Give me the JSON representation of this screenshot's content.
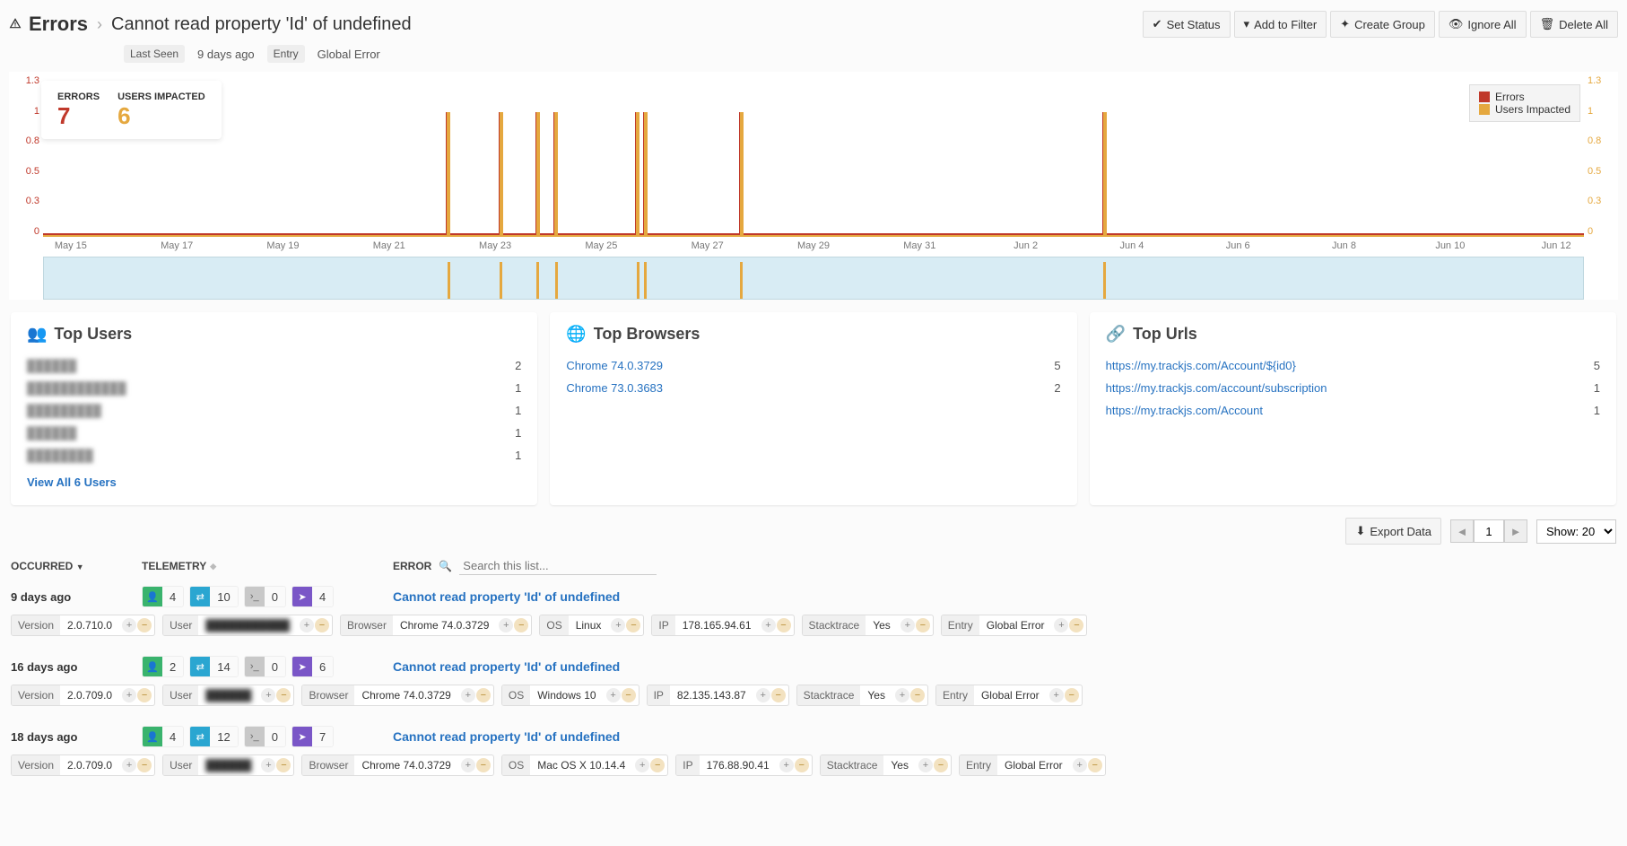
{
  "page": {
    "title": "Errors",
    "error_name": "Cannot read property 'Id' of undefined",
    "last_seen_label": "Last Seen",
    "last_seen_value": "9 days ago",
    "entry_label": "Entry",
    "entry_value": "Global Error"
  },
  "actions": {
    "set_status": "Set Status",
    "add_filter": "Add to Filter",
    "create_group": "Create Group",
    "ignore_all": "Ignore All",
    "delete_all": "Delete All"
  },
  "summary": {
    "errors_label": "ERRORS",
    "errors_value": "7",
    "users_label": "USERS IMPACTED",
    "users_value": "6"
  },
  "legend": {
    "errors": "Errors",
    "users": "Users Impacted"
  },
  "chart_data": {
    "type": "bar",
    "y_left_ticks": [
      "1.3",
      "1",
      "0.8",
      "0.5",
      "0.3",
      "0"
    ],
    "y_right_ticks": [
      "1.3",
      "1",
      "0.8",
      "0.5",
      "0.3",
      "0"
    ],
    "x_ticks": [
      "May 15",
      "May 17",
      "May 19",
      "May 21",
      "May 23",
      "May 25",
      "May 27",
      "May 29",
      "May 31",
      "Jun 2",
      "Jun 4",
      "Jun 6",
      "Jun 8",
      "Jun 10",
      "Jun 12"
    ],
    "x_range": [
      "May 14",
      "Jun 12"
    ],
    "spikes_pct": [
      26.2,
      29.6,
      32.0,
      33.2,
      38.5,
      39.0,
      45.2,
      68.8
    ],
    "series": [
      {
        "name": "Errors",
        "color": "#c0392b",
        "value_per_spike": 1
      },
      {
        "name": "Users Impacted",
        "color": "#e5a83f",
        "value_per_spike": 1
      }
    ],
    "ylim": [
      0,
      1.3
    ]
  },
  "top_users": {
    "title": "Top Users",
    "items": [
      {
        "name": "██████",
        "count": "2"
      },
      {
        "name": "████████████",
        "count": "1"
      },
      {
        "name": "█████████",
        "count": "1"
      },
      {
        "name": "██████",
        "count": "1"
      },
      {
        "name": "████████",
        "count": "1"
      }
    ],
    "view_all": "View All 6 Users"
  },
  "top_browsers": {
    "title": "Top Browsers",
    "items": [
      {
        "name": "Chrome 74.0.3729",
        "count": "5"
      },
      {
        "name": "Chrome 73.0.3683",
        "count": "2"
      }
    ]
  },
  "top_urls": {
    "title": "Top Urls",
    "items": [
      {
        "name": "https://my.trackjs.com/Account/${id0}",
        "count": "5"
      },
      {
        "name": "https://my.trackjs.com/account/subscription",
        "count": "1"
      },
      {
        "name": "https://my.trackjs.com/Account",
        "count": "1"
      }
    ]
  },
  "toolbar": {
    "export": "Export Data",
    "page": "1",
    "show": "Show: 20"
  },
  "list_headers": {
    "occurred": "OCCURRED",
    "telemetry": "TELEMETRY",
    "error": "ERROR",
    "search_placeholder": "Search this list..."
  },
  "meta_labels": {
    "version": "Version",
    "user": "User",
    "browser": "Browser",
    "os": "OS",
    "ip": "IP",
    "stacktrace": "Stacktrace",
    "entry": "Entry"
  },
  "rows": [
    {
      "occurred": "9 days ago",
      "t_user": "4",
      "t_net": "10",
      "t_console": "0",
      "t_nav": "4",
      "error": "Cannot read property 'Id' of undefined",
      "version": "2.0.710.0",
      "user": "███████████",
      "browser": "Chrome 74.0.3729",
      "os": "Linux",
      "ip": "178.165.94.61",
      "stacktrace": "Yes",
      "entry": "Global Error"
    },
    {
      "occurred": "16 days ago",
      "t_user": "2",
      "t_net": "14",
      "t_console": "0",
      "t_nav": "6",
      "error": "Cannot read property 'Id' of undefined",
      "version": "2.0.709.0",
      "user": "██████",
      "browser": "Chrome 74.0.3729",
      "os": "Windows 10",
      "ip": "82.135.143.87",
      "stacktrace": "Yes",
      "entry": "Global Error"
    },
    {
      "occurred": "18 days ago",
      "t_user": "4",
      "t_net": "12",
      "t_console": "0",
      "t_nav": "7",
      "error": "Cannot read property 'Id' of undefined",
      "version": "2.0.709.0",
      "user": "██████",
      "browser": "Chrome 74.0.3729",
      "os": "Mac OS X 10.14.4",
      "ip": "176.88.90.41",
      "stacktrace": "Yes",
      "entry": "Global Error"
    }
  ]
}
